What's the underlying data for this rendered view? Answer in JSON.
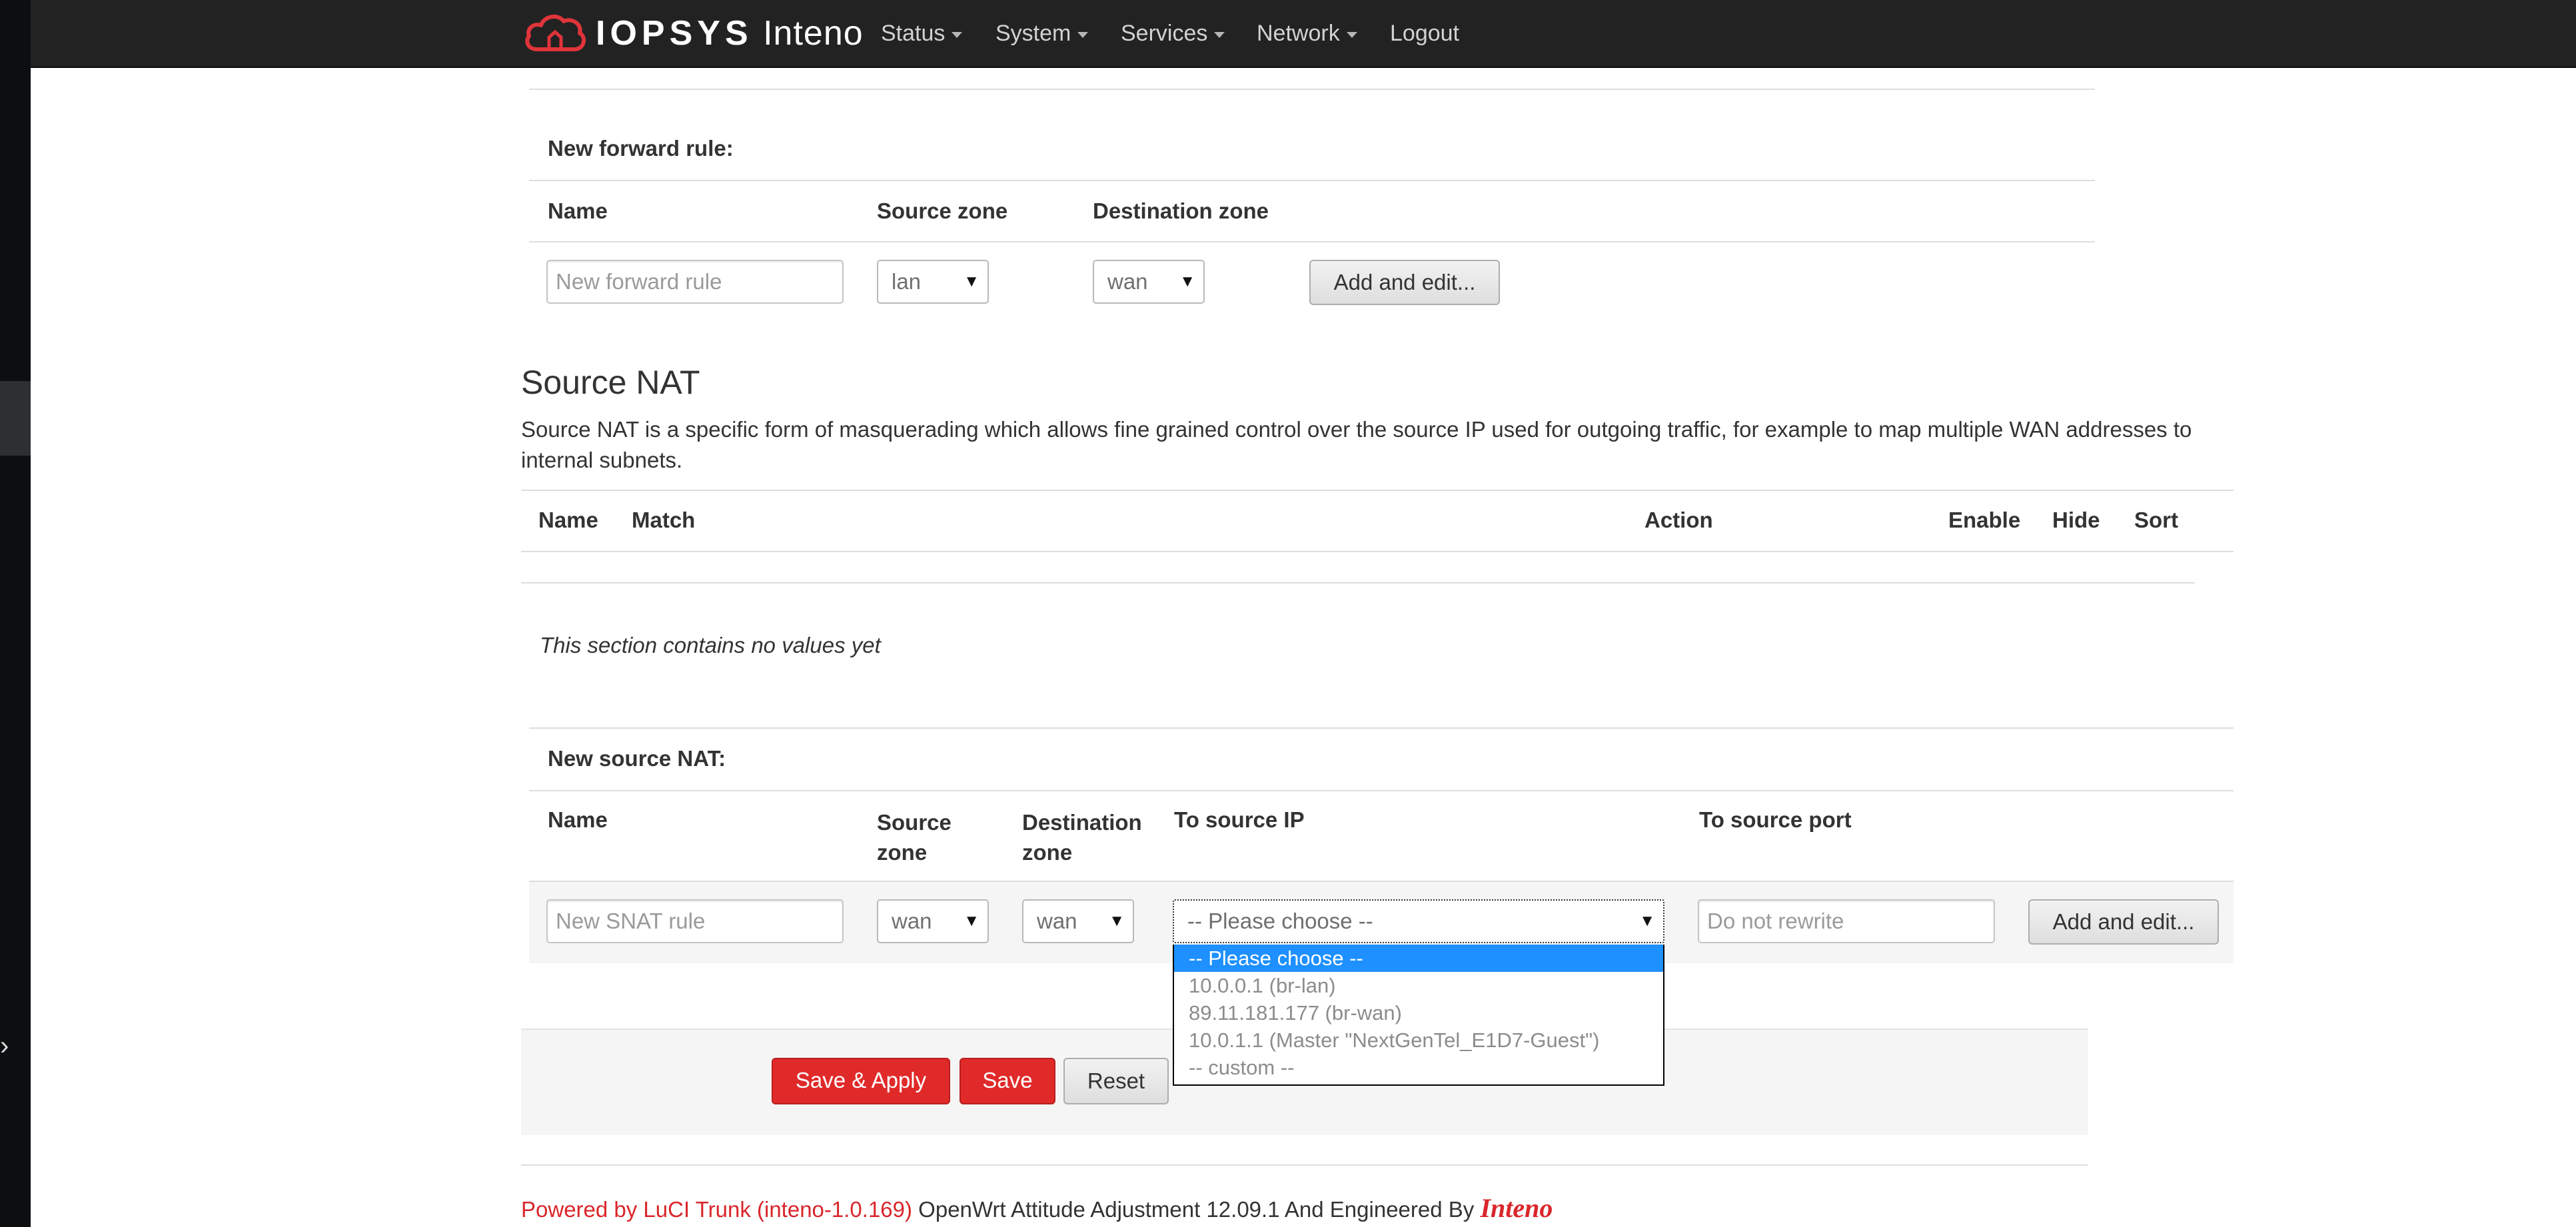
{
  "nav": {
    "brand_bold": "IOPSYS",
    "brand_light": "Inteno",
    "items": [
      "Status",
      "System",
      "Services",
      "Network",
      "Logout"
    ]
  },
  "forward": {
    "title": "New forward rule:",
    "headers": [
      "Name",
      "Source zone",
      "Destination zone"
    ],
    "name_placeholder": "New forward rule",
    "source_zone": "lan",
    "dest_zone": "wan",
    "add_button": "Add and edit..."
  },
  "snat": {
    "heading": "Source NAT",
    "description": "Source NAT is a specific form of masquerading which allows fine grained control over the source IP used for outgoing traffic, for example to map multiple WAN addresses to internal subnets.",
    "table_headers": [
      "Name",
      "Match",
      "Action",
      "Enable",
      "Hide",
      "Sort"
    ],
    "empty_text": "This section contains no values yet",
    "new_title": "New source NAT:",
    "new_headers": {
      "name": "Name",
      "source_zone_1": "Source",
      "source_zone_2": "zone",
      "dest_zone_1": "Destination",
      "dest_zone_2": "zone",
      "to_source_ip": "To source IP",
      "to_source_port": "To source port"
    },
    "name_placeholder": "New SNAT rule",
    "source_zone": "wan",
    "dest_zone": "wan",
    "to_source_ip_value": "-- Please choose --",
    "to_source_port_placeholder": "Do not rewrite",
    "add_button": "Add and edit...",
    "dropdown_options": [
      "-- Please choose --",
      "10.0.0.1 (br-lan)",
      "89.11.181.177 (br-wan)",
      "10.0.1.1 (Master \"NextGenTel_E1D7-Guest\")",
      "-- custom --"
    ]
  },
  "actions": {
    "save_apply": "Save & Apply",
    "save": "Save",
    "reset": "Reset"
  },
  "footer": {
    "powered": "Powered by LuCI Trunk (inteno-1.0.169)",
    "rest": " OpenWrt Attitude Adjustment 12.09.1 And Engineered By ",
    "logo": "Inteno"
  },
  "colors": {
    "navbar": "#222222",
    "accent_red": "#e02a2a",
    "select_highlight": "#1e90ff"
  }
}
